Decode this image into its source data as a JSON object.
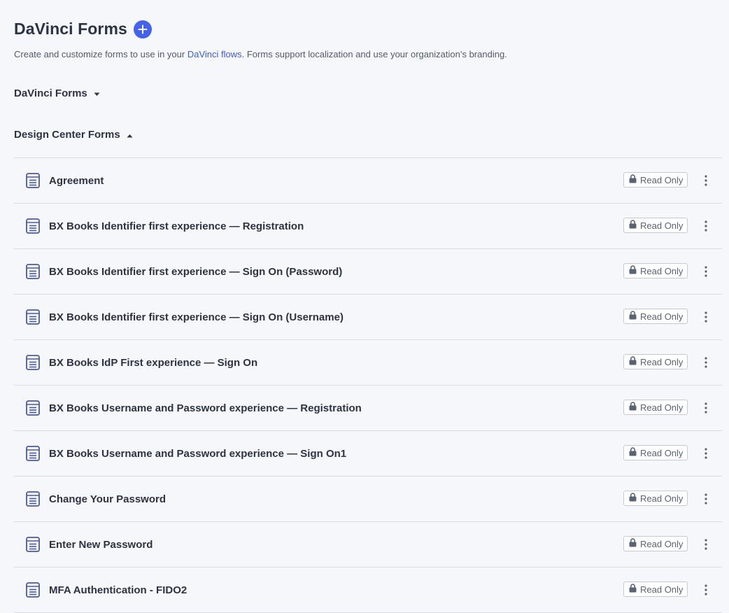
{
  "header": {
    "title": "DaVinci Forms",
    "add_icon": "plus-circle-icon"
  },
  "description": {
    "before": "Create and customize forms to use in your ",
    "link": "DaVinci flows",
    "after": ". Forms support localization and use your organization’s branding."
  },
  "sections": [
    {
      "label": "DaVinci Forms",
      "state": "collapsed"
    },
    {
      "label": "Design Center Forms",
      "state": "expanded"
    }
  ],
  "forms": [
    {
      "name": "Agreement",
      "badge": "Read Only"
    },
    {
      "name": "BX Books Identifier first experience — Registration",
      "badge": "Read Only"
    },
    {
      "name": "BX Books Identifier first experience — Sign On (Password)",
      "badge": "Read Only"
    },
    {
      "name": "BX Books Identifier first experience — Sign On (Username)",
      "badge": "Read Only"
    },
    {
      "name": "BX Books IdP First experience — Sign On",
      "badge": "Read Only"
    },
    {
      "name": "BX Books Username and Password experience — Registration",
      "badge": "Read Only"
    },
    {
      "name": "BX Books Username and Password experience — Sign On1",
      "badge": "Read Only"
    },
    {
      "name": "Change Your Password",
      "badge": "Read Only"
    },
    {
      "name": "Enter New Password",
      "badge": "Read Only"
    },
    {
      "name": "MFA Authentication - FIDO2",
      "badge": "Read Only"
    }
  ],
  "colors": {
    "accent": "#4462ed",
    "link": "#3b5bdb",
    "icon": "#4a5a9c",
    "background": "#f6f7fb"
  }
}
